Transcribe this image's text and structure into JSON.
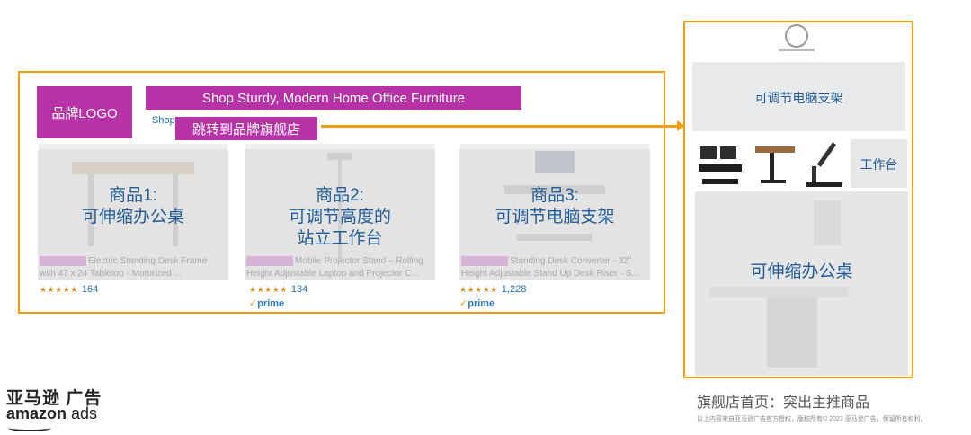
{
  "ad": {
    "logo_label": "品牌LOGO",
    "headline": "Shop Sturdy, Modern Home Office Furniture",
    "shop_link": "Shop",
    "shop_tag": "跳转到品牌旗舰店",
    "products": [
      {
        "label_lines": [
          "商品1:",
          "可伸缩办公桌"
        ],
        "desc_line1": "Electric Standing Desk Frame",
        "desc_line2": "with 47 x 24 Tabletop - Motorized ...",
        "rating": "164",
        "prime": ""
      },
      {
        "label_lines": [
          "商品2:",
          "可调节高度的",
          "站立工作台"
        ],
        "desc_line1": "Mobile Projector Stand – Rolling",
        "desc_line2": "Height Adjustable Laptop and Projector C...",
        "rating": "134",
        "prime": "prime"
      },
      {
        "label_lines": [
          "商品3:",
          "可调节电脑支架"
        ],
        "desc_line1": "Standing Desk Converter - 32\"",
        "desc_line2": "Height Adjustable Stand Up Desk Riser - S...",
        "rating": "1,228",
        "prime": "prime"
      }
    ],
    "stars_glyph": "★★★★★"
  },
  "store": {
    "tile1_label": "可调节电脑支架",
    "thumb_label": "工作台",
    "tile2_label": "可伸缩办公桌",
    "caption": "旗舰店首页：突出主推商品",
    "fineprint": "以上内容来自亚马逊广告官方授权，版权所有© 2023 亚马逊广告，保留所有权利。"
  },
  "brand": {
    "cn": "亚马逊 广告",
    "en_bold": "amazon",
    "en_rest": " ads"
  },
  "colors": {
    "accent_orange": "#f39c12",
    "magenta": "#b832a7",
    "label_blue": "#215c98",
    "link_blue": "#1f6fb0"
  }
}
